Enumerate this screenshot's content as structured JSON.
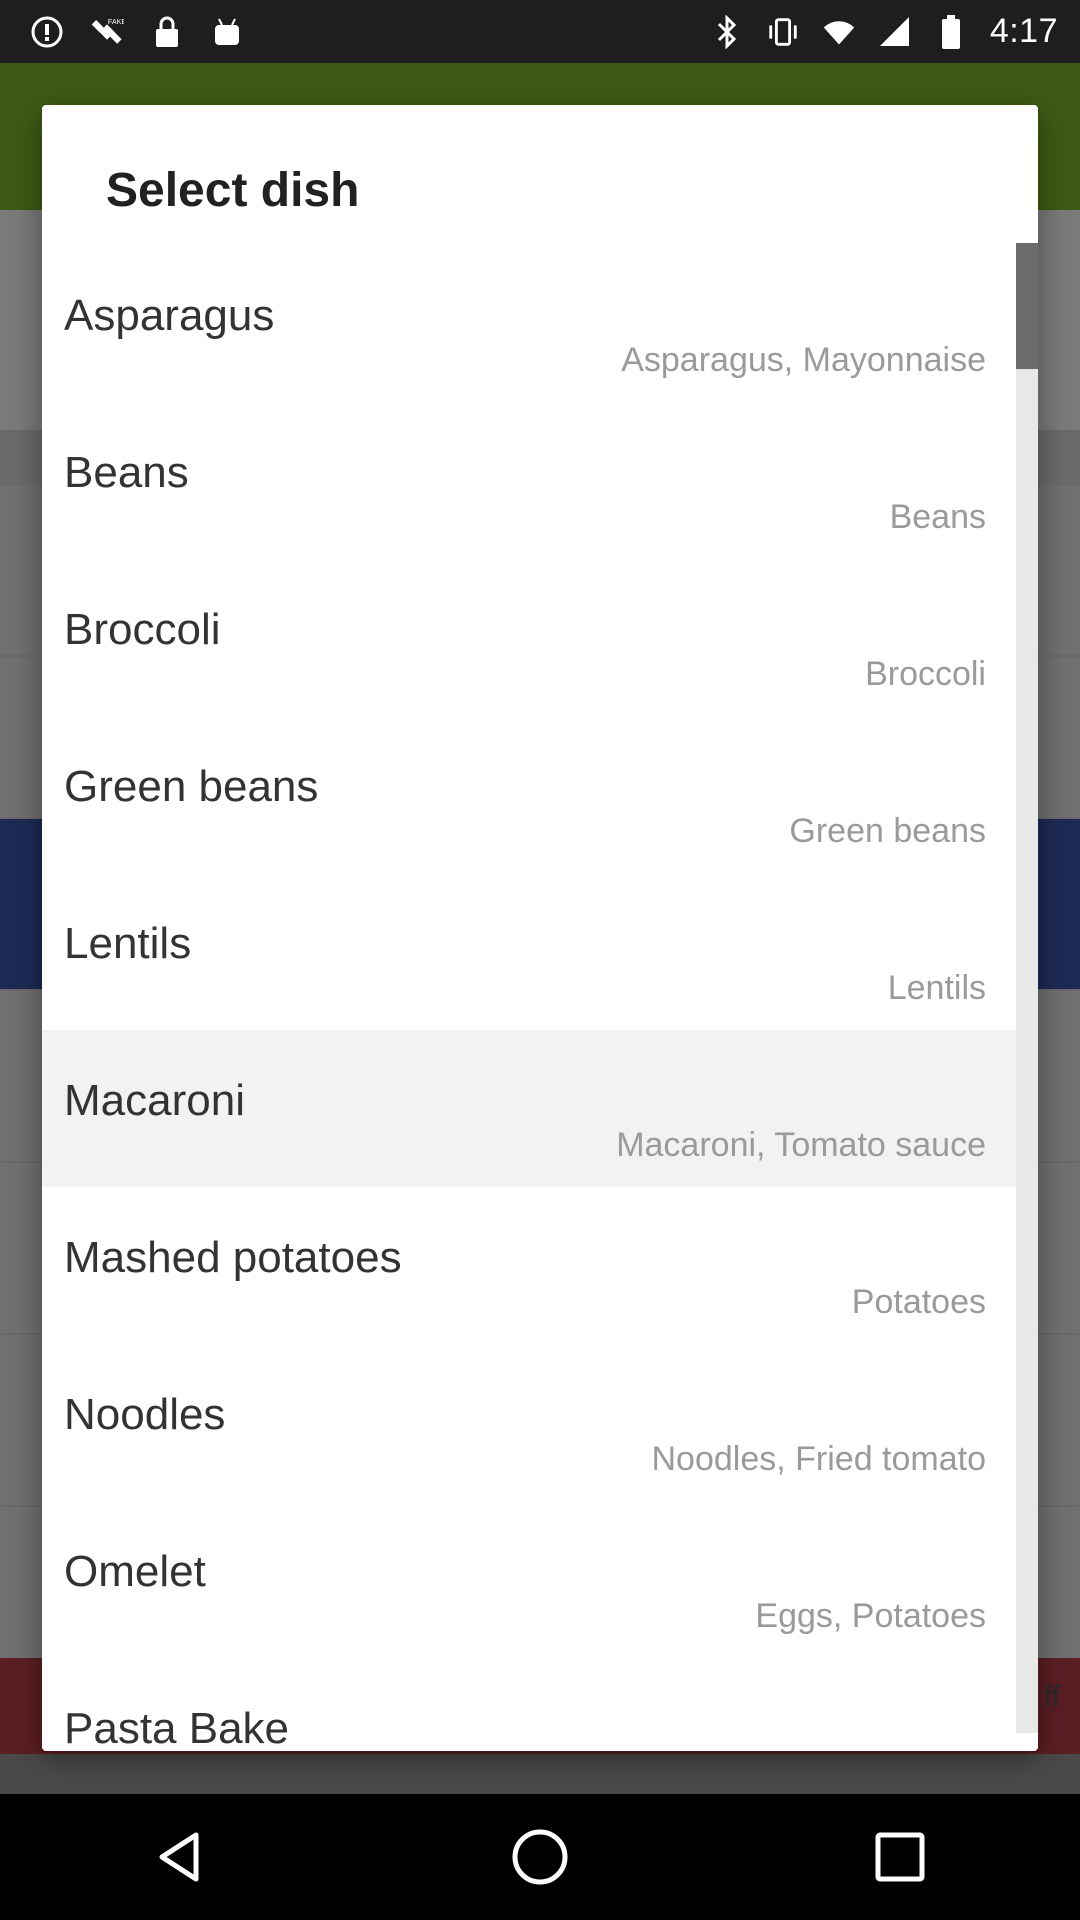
{
  "status_bar": {
    "time": "4:17",
    "icons_left": [
      "alert-circle-icon",
      "fake-gps-icon",
      "lock-icon",
      "android-icon"
    ],
    "icons_right": [
      "bluetooth-icon",
      "vibrate-icon",
      "wifi-icon",
      "cellular-icon",
      "battery-icon"
    ]
  },
  "background_app": {
    "bottom_right_text": "ff"
  },
  "dialog": {
    "title": "Select dish",
    "items": [
      {
        "name": "Asparagus",
        "description": "Asparagus, Mayonnaise"
      },
      {
        "name": "Beans",
        "description": "Beans"
      },
      {
        "name": "Broccoli",
        "description": "Broccoli"
      },
      {
        "name": "Green beans",
        "description": "Green beans"
      },
      {
        "name": "Lentils",
        "description": "Lentils"
      },
      {
        "name": "Macaroni",
        "description": "Macaroni, Tomato sauce",
        "highlighted": true
      },
      {
        "name": "Mashed potatoes",
        "description": "Potatoes"
      },
      {
        "name": "Noodles",
        "description": "Noodles, Fried tomato"
      },
      {
        "name": "Omelet",
        "description": "Eggs, Potatoes"
      },
      {
        "name": "Pasta Bake",
        "description": ""
      }
    ]
  },
  "navigation": [
    "back-icon",
    "home-icon",
    "recents-icon"
  ]
}
